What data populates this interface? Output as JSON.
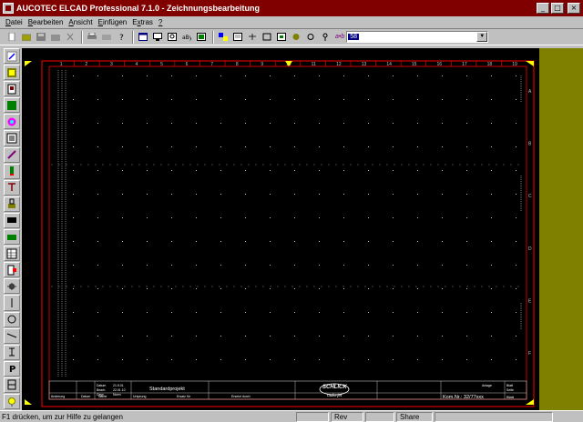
{
  "window": {
    "title": "AUCOTEC ELCAD Professional 7.1.0 - Zeichnungsbearbeitung",
    "minimize": "_",
    "maximize": "□",
    "close": "×"
  },
  "menu": [
    {
      "accel": "D",
      "rest": "atei"
    },
    {
      "accel": "B",
      "rest": "earbeiten"
    },
    {
      "accel": "A",
      "rest": "nsicht"
    },
    {
      "accel": "E",
      "rest": "infügen"
    },
    {
      "accel": "x",
      "pre": "E",
      "rest": "tras"
    },
    {
      "accel": "?",
      "rest": ""
    }
  ],
  "toolbar": {
    "text_label": "a•b",
    "combo_value": "58"
  },
  "drawing": {
    "top_ruler": [
      "1",
      "2",
      "3",
      "4",
      "5",
      "6",
      "7",
      "8",
      "9",
      "10",
      "11",
      "12",
      "13",
      "14",
      "15",
      "16",
      "17",
      "18",
      "19"
    ],
    "side_ruler": [
      "A",
      "B",
      "C",
      "D",
      "E",
      "F"
    ],
    "title_block": {
      "standard_text": "Standardprojekt",
      "company_logo": "SCHLICK",
      "company_sub": "radio-jet",
      "drawing_number": "Kom.Nr.: 32/77xxx",
      "sheet": "Blatt",
      "labels": [
        "Datum",
        "Bearb.",
        "Gepr.",
        "Norm",
        "Änderung",
        "Datum",
        "Name",
        "Ursprung",
        "Ersatz für",
        "Ersetzt durch"
      ],
      "dates": [
        "21.5.01",
        "22.01.10"
      ],
      "small_right": [
        "Anlage",
        "Blatt",
        "Seite"
      ]
    }
  },
  "status": {
    "message": "F1 drücken, um zur Hilfe zu gelangen",
    "pane1": "Rev",
    "pane2": "",
    "pane3": "Share",
    "pane4": ""
  },
  "colors": {
    "titlebar": "#800000",
    "frame": "#ff0000",
    "grid": "#c0c0c0",
    "background": "#808000"
  }
}
